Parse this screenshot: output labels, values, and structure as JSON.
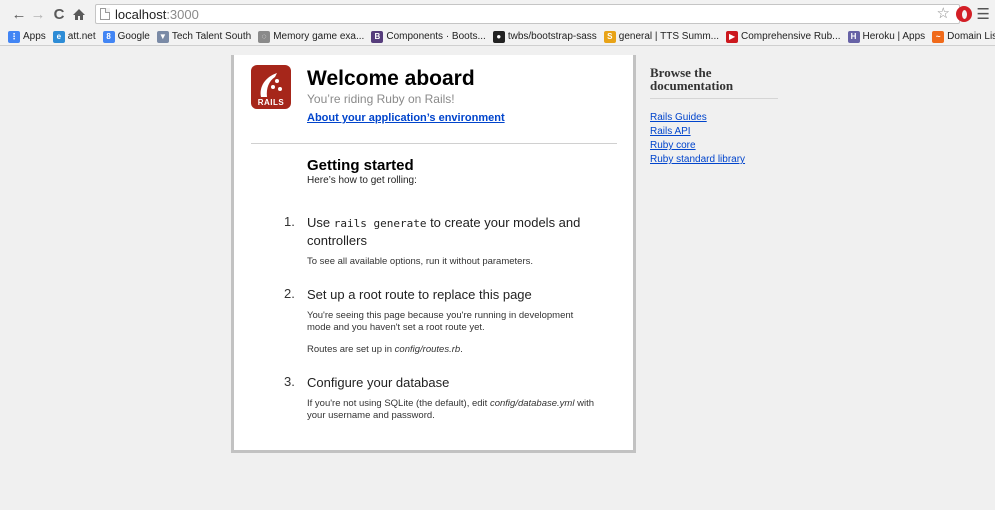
{
  "browser": {
    "url_host": "localhost",
    "url_port": ":3000"
  },
  "bookmarks": [
    {
      "label": "Apps",
      "color": "#4285f4"
    },
    {
      "label": "att.net",
      "color": "#2d8cd6"
    },
    {
      "label": "Google",
      "color": "#4285f4"
    },
    {
      "label": "Tech Talent South",
      "color": "#7a8aa6"
    },
    {
      "label": "Memory game exa...",
      "color": "#8a8a8a"
    },
    {
      "label": "Components · Boots...",
      "color": "#563d7c"
    },
    {
      "label": "twbs/bootstrap-sass",
      "color": "#222222"
    },
    {
      "label": "general | TTS Summ...",
      "color": "#e8a317"
    },
    {
      "label": "Comprehensive Rub...",
      "color": "#cc181e"
    },
    {
      "label": "Heroku | Apps",
      "color": "#6762a6"
    },
    {
      "label": "Domain List",
      "color": "#f06a1a"
    }
  ],
  "rails": {
    "logo_text": "RAILS",
    "title": "Welcome aboard",
    "subtitle": "You’re riding Ruby on Rails!",
    "env_link": "About your application’s environment",
    "getting_started_title": "Getting started",
    "getting_started_sub": "Here’s how to get rolling:",
    "steps": [
      {
        "num": "1.",
        "title_pre": "Use ",
        "title_code": "rails generate",
        "title_post": " to create your models and controllers",
        "text1": "To see all available options, run it without parameters."
      },
      {
        "num": "2.",
        "title": "Set up a root route to replace this page",
        "text1": "You're seeing this page because you're running in development mode and you haven't set a root route yet.",
        "text2_pre": "Routes are set up in ",
        "text2_em": "config/routes.rb",
        "text2_post": "."
      },
      {
        "num": "3.",
        "title": "Configure your database",
        "text1_pre": "If you're not using SQLite (the default), edit ",
        "text1_em": "config/database.yml",
        "text1_post": " with your username and password."
      }
    ]
  },
  "sidebar": {
    "title": "Browse the documentation",
    "links": [
      "Rails Guides",
      "Rails API",
      "Ruby core",
      "Ruby standard library"
    ]
  }
}
